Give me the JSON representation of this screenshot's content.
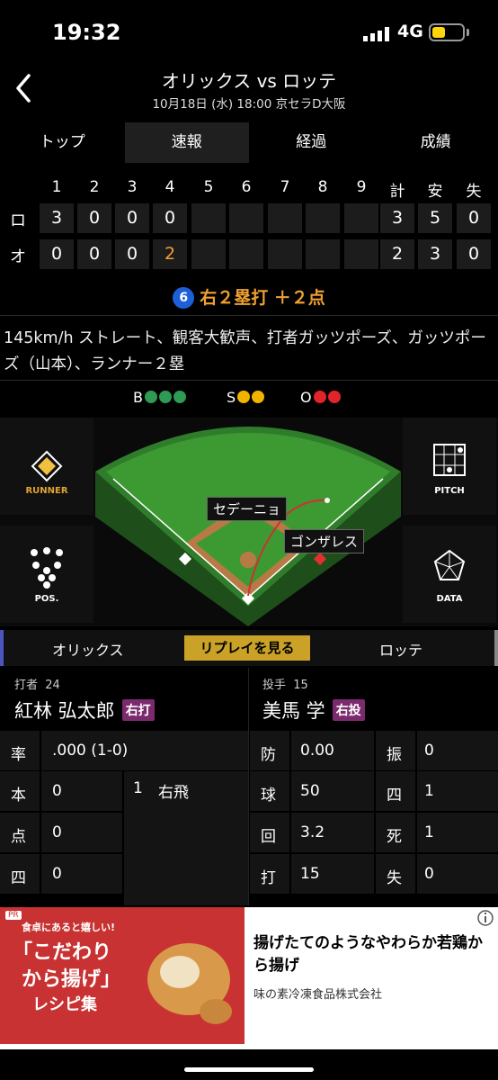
{
  "status": {
    "time": "19:32",
    "network": "4G"
  },
  "header": {
    "title": "オリックス vs ロッテ",
    "subtitle": "10月18日 (水) 18:00 京セラD大阪"
  },
  "tabs": [
    "トップ",
    "速報",
    "経過",
    "成績"
  ],
  "scoreboard": {
    "headers": [
      "1",
      "2",
      "3",
      "4",
      "5",
      "6",
      "7",
      "8",
      "9",
      "計",
      "安",
      "失"
    ],
    "rows": [
      {
        "team": "ロ",
        "innings": [
          "3",
          "0",
          "0",
          "0",
          "",
          "",
          "",
          "",
          ""
        ],
        "totals": [
          "3",
          "5",
          "0"
        ]
      },
      {
        "team": "オ",
        "innings": [
          "0",
          "0",
          "0",
          "2",
          "",
          "",
          "",
          "",
          ""
        ],
        "totals": [
          "2",
          "3",
          "0"
        ]
      }
    ],
    "current_color": "#f0a030"
  },
  "play": {
    "number": "6",
    "text": "右２塁打 ＋２点"
  },
  "description": "145km/h ストレート、観客大歓声、打者ガッツポーズ、ガッツポーズ（山本）、ランナー２塁",
  "count": {
    "b": "B",
    "s": "S",
    "o": "O",
    "balls": 3,
    "strikes": 2,
    "outs": 2
  },
  "field": {
    "tiles": {
      "runner": "RUNNER",
      "pitch": "PITCH",
      "pos": "POS.",
      "data": "DATA"
    },
    "label_cf": "セデーニョ",
    "label_rf": "ゴンザレス"
  },
  "player_tabs": {
    "home": "オリックス",
    "replay": "リプレイを見る",
    "away": "ロッテ"
  },
  "batter": {
    "role": "打者",
    "number": "24",
    "name": "紅林 弘太郎",
    "hand": "右打",
    "stats": [
      {
        "k": "率",
        "v": ".000 (1-0)"
      },
      {
        "k": "本",
        "v": "0"
      },
      {
        "k": "点",
        "v": "0"
      },
      {
        "k": "四",
        "v": "0"
      }
    ],
    "at_bats": [
      {
        "n": "1",
        "result": "右飛"
      }
    ]
  },
  "pitcher": {
    "role": "投手",
    "number": "15",
    "name": "美馬 学",
    "hand": "右投",
    "stats_left": [
      {
        "k": "防",
        "v": "0.00"
      },
      {
        "k": "球",
        "v": "50"
      },
      {
        "k": "回",
        "v": "3.2"
      },
      {
        "k": "打",
        "v": "15"
      }
    ],
    "stats_right": [
      {
        "k": "振",
        "v": "0"
      },
      {
        "k": "四",
        "v": "1"
      },
      {
        "k": "死",
        "v": "1"
      },
      {
        "k": "失",
        "v": "0"
      }
    ]
  },
  "ad": {
    "badge": "PR",
    "img_tag": "食卓にあると嬉しい!",
    "img_line1": "「こだわり",
    "img_line2": "から揚げ」",
    "img_line3": "レシピ集",
    "title": "揚げたてのようなやわらか若鶏から揚げ",
    "source": "味の素冷凍食品株式会社"
  }
}
